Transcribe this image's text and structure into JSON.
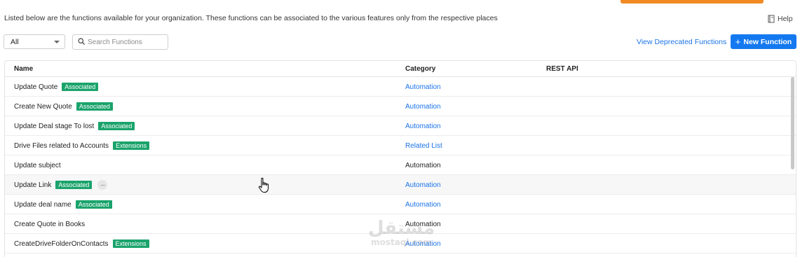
{
  "header": {
    "intro": "Listed below are the functions available for your organization. These functions can be associated to the various features only from the respective places",
    "help_label": "Help"
  },
  "toolbar": {
    "filter_selected": "All",
    "search_placeholder": "Search Functions",
    "search_value": "",
    "deprecated_link": "View Deprecated Functions",
    "new_function_label": "New Function",
    "new_function_plus": "+"
  },
  "table": {
    "columns": {
      "name": "Name",
      "category": "Category",
      "rest_api": "REST API"
    },
    "rows": [
      {
        "name": "Update Quote",
        "badge": "Associated",
        "category": "Automation"
      },
      {
        "name": "Create New Quote",
        "badge": "Associated",
        "category": "Automation"
      },
      {
        "name": "Update Deal stage To lost",
        "badge": "Associated",
        "category": "Automation"
      },
      {
        "name": "Drive Files related to Accounts",
        "badge": "Extensions",
        "category": "Related List"
      },
      {
        "name": "Update subject",
        "badge": "",
        "category": "Automation"
      },
      {
        "name": "Update Link",
        "badge": "Associated",
        "category": "Automation",
        "more": "···"
      },
      {
        "name": "Update deal name",
        "badge": "Associated",
        "category": "Automation"
      },
      {
        "name": "Create Quote in Books",
        "badge": "",
        "category": "Automation"
      },
      {
        "name": "CreateDriveFolderOnContacts",
        "badge": "Extensions",
        "category": "Automation"
      }
    ]
  },
  "watermark": {
    "arabic": "مستقل",
    "latin": "mostaql.com"
  },
  "colors": {
    "accent_blue": "#1479f0",
    "link_blue": "#1a73e8",
    "badge_green": "#1aa36b",
    "top_bar_orange": "#f28a24"
  },
  "icons": {
    "help": "help-book-icon",
    "search": "search-icon",
    "dropdown": "chevron-down-icon",
    "more": "more-horizontal-icon",
    "cursor": "hand-pointer-icon"
  }
}
